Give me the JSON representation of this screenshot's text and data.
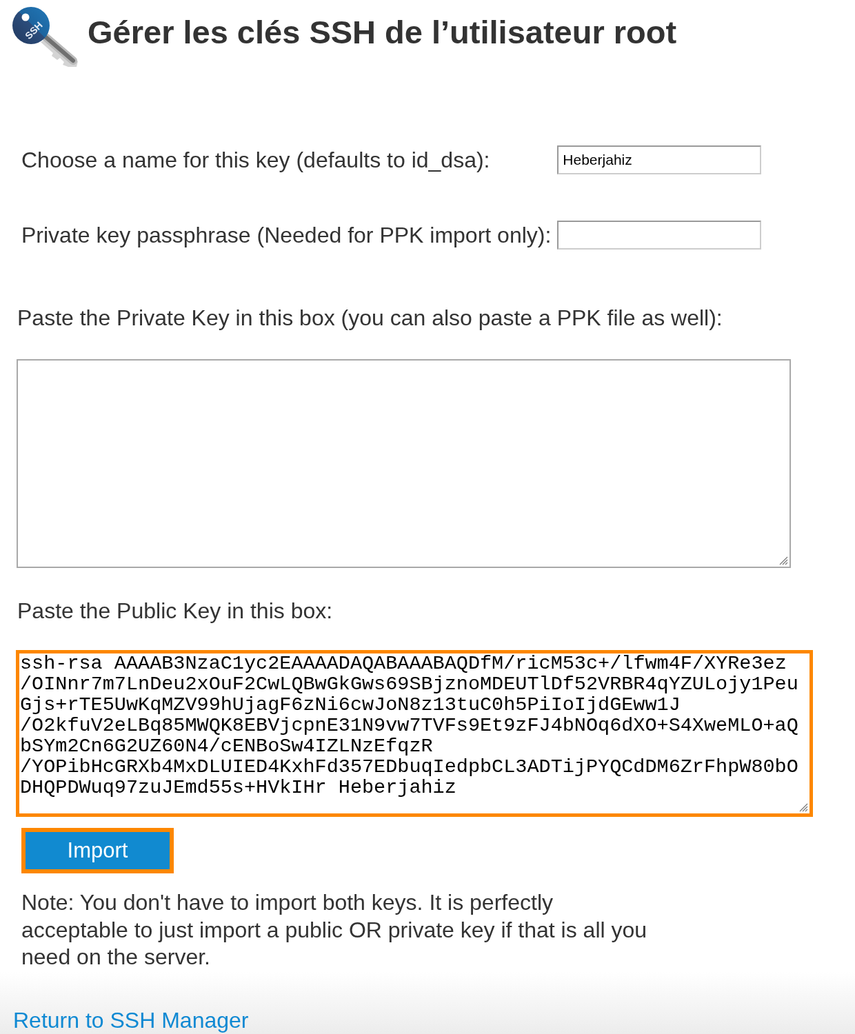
{
  "header": {
    "icon_label": "SSH",
    "title": "Gérer les clés SSH de l’utilisateur root"
  },
  "fields": [
    {
      "label": "Choose a name for this key (defaults to id_dsa):",
      "value": "Heberjahiz"
    },
    {
      "label": "Private key passphrase (Needed for PPK import only):"
    }
  ],
  "private_key": {
    "label": "Paste the Private Key in this box (you can also paste a PPK file as well):",
    "highlighted": false
  },
  "public_key": {
    "label": "Paste the Public Key in this box:",
    "value": "ssh-rsa AAAAB3NzaC1yc2EAAAADAQABAAABAQDfM/ricM53c+/lfwm4F/XYRe3ez/OINnr7m7LnDeu2xOuF2CwLQBwGkGws69SBjznoMDEUTlDf52VRBR4qYZULojy1PeuGjs+rTE5UwKqMZV99hUjagF6zNi6cwJoN8z13tuC0h5PiIoIjdGEww1J/O2kfuV2eLBq85MWQK8EBVjcpnE31N9vw7TVFs9Et9zFJ4bNOq6dXO+S4XweMLO+aQbSYm2Cn6G2UZ60N4/cENBoSw4IZLNzEfqzR/YOPibHcGRXb4MxDLUIED4KxhFd357EDbuqIedpbCL3ADTijPYQCdDM6ZrFhpW80bODHQPDWuq97zuJEmd55s+HVkIHr Heberjahiz",
    "highlighted": true
  },
  "import_button": {
    "label": "Import",
    "highlighted": true
  },
  "note": "Note: You don't have to import both keys. It is perfectly acceptable to just import a public OR private key if that is all you need on the server.",
  "footer": {
    "link": "Return to SSH Manager"
  }
}
